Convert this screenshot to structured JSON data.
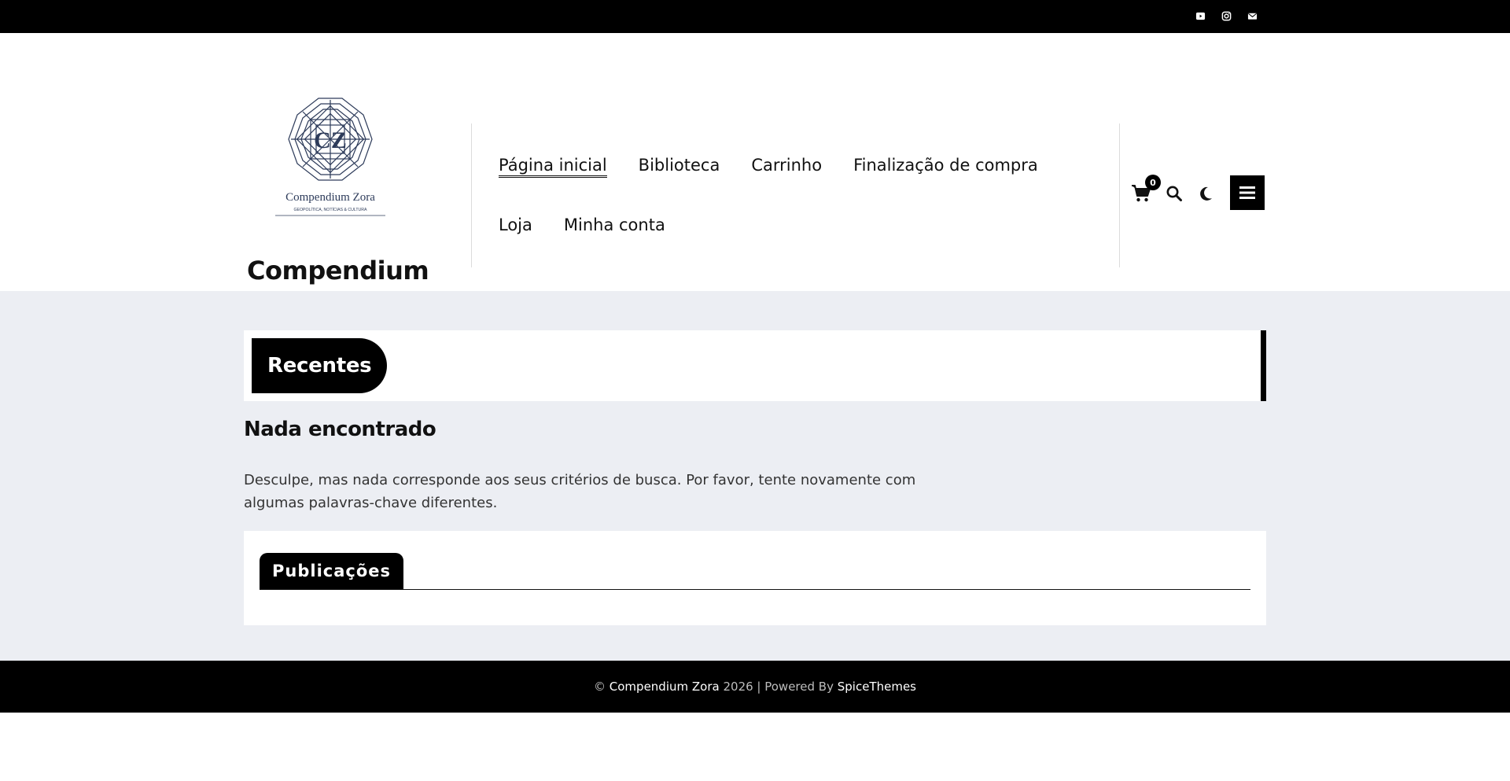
{
  "topbar": {
    "social": [
      {
        "icon": "youtube-icon"
      },
      {
        "icon": "instagram-icon"
      },
      {
        "icon": "email-icon"
      }
    ]
  },
  "header": {
    "logo": {
      "monogram": "CZ",
      "name": "Compendium Zora",
      "tagline": "GEOPOLÍTICA, NOTÍCIAS & CULTURA"
    },
    "site_title": "Compendium Zora",
    "nav": [
      {
        "label": "Página inicial",
        "active": true
      },
      {
        "label": "Biblioteca"
      },
      {
        "label": "Carrinho"
      },
      {
        "label": "Finalização de compra"
      },
      {
        "label": "Loja"
      },
      {
        "label": "Minha conta"
      }
    ],
    "cart_count": "0",
    "icons": [
      "cart-icon",
      "search-icon",
      "moon-icon",
      "menu-icon"
    ]
  },
  "main": {
    "recent_label": "Recentes",
    "not_found_title": "Nada encontrado",
    "not_found_text": "Desculpe, mas nada corresponde aos seus critérios de busca. Por favor, tente novamente com algumas palavras-chave diferentes.",
    "posts_tab": "Publicações"
  },
  "footer": {
    "copyright": "©",
    "site": "Compendium Zora",
    "year_text": "2026 | Powered By",
    "theme": "SpiceThemes"
  },
  "colors": {
    "primary": "#000000",
    "background": "#eceef3",
    "logo_blue": "#2d3b5a"
  }
}
